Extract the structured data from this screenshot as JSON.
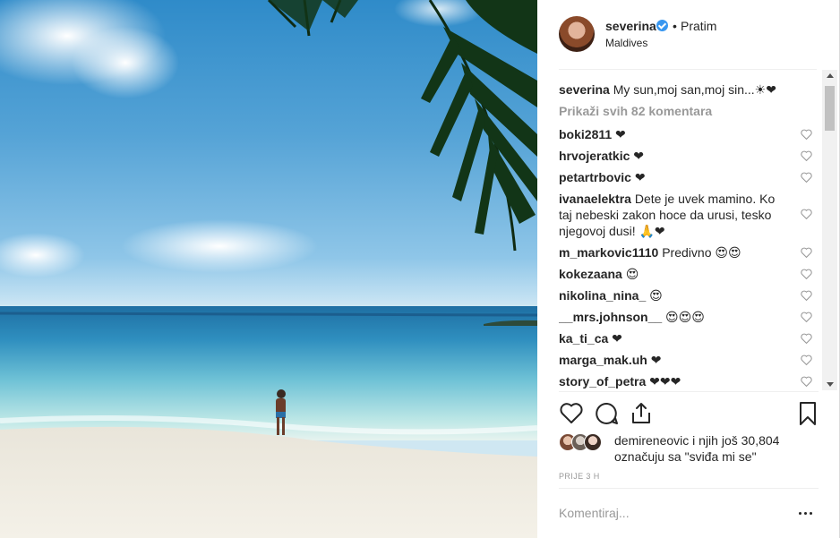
{
  "post": {
    "username": "severina",
    "separator": "•",
    "follow_label": "Pratim",
    "location": "Maldives",
    "verified": true
  },
  "caption": {
    "username": "severina",
    "text": "My sun,moj san,moj sin...☀❤"
  },
  "view_all_label": "Prikaži svih 82 komentara",
  "comments": [
    {
      "user": "boki2811",
      "text": "❤"
    },
    {
      "user": "hrvojeratkic",
      "text": "❤"
    },
    {
      "user": "petartrbovic",
      "text": "❤"
    },
    {
      "user": "ivanaelektra",
      "text": "Dete je uvek mamino. Ko taj nebeski zakon hoce da urusi, tesko njegovoj dusi! 🙏❤"
    },
    {
      "user": "m_markovic1110",
      "text": "Predivno 😍😍"
    },
    {
      "user": "kokezaana",
      "text": "😍"
    },
    {
      "user": "nikolina_nina_",
      "text": "😍"
    },
    {
      "user": "__mrs.johnson__",
      "text": "😍😍😍"
    },
    {
      "user": "ka_ti_ca",
      "text": "❤"
    },
    {
      "user": "marga_mak.uh",
      "text": "❤"
    },
    {
      "user": "story_of_petra",
      "text": "❤❤❤"
    }
  ],
  "likes": {
    "line1": "demireneovic i njih još 30,804",
    "line2": "označuju sa \"sviđa mi se\""
  },
  "timestamp": "PRIJE 3 H",
  "add_comment_placeholder": "Komentiraj...",
  "colors": {
    "link_blue": "#3897f0",
    "text": "#262626",
    "muted": "#999999",
    "divider": "#efefef"
  },
  "icons": [
    "verified-badge-icon",
    "heart-icon",
    "comment-icon",
    "share-icon",
    "bookmark-icon",
    "more-options-icon"
  ]
}
